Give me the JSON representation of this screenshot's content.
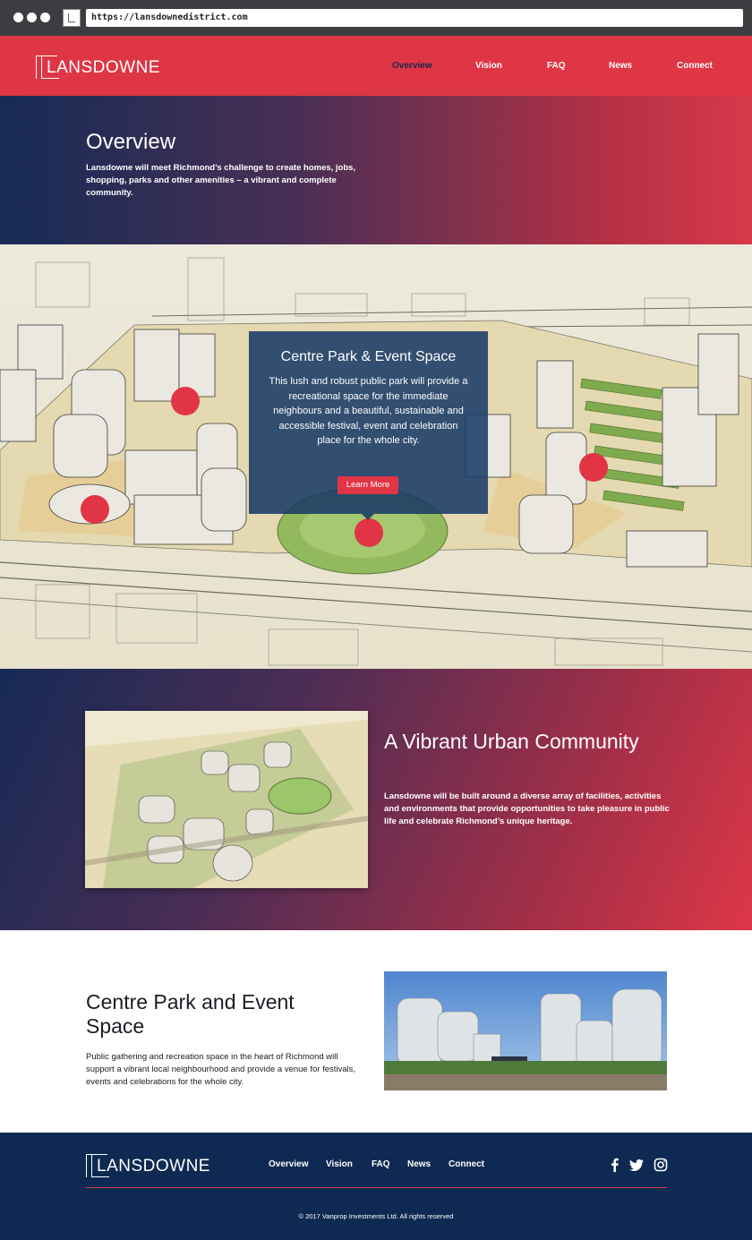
{
  "browser": {
    "url": "https://lansdownedistrict.com"
  },
  "header": {
    "logo": "LANSDOWNE",
    "nav": [
      {
        "label": "Overview",
        "active": true
      },
      {
        "label": "Vision",
        "active": false
      },
      {
        "label": "FAQ",
        "active": false
      },
      {
        "label": "News",
        "active": false
      },
      {
        "label": "Connect",
        "active": false
      }
    ]
  },
  "overview": {
    "title": "Overview",
    "text": "Lansdowne will meet Richmond’s challenge to create homes, jobs, shopping, parks and other amenities – a vibrant and complete community."
  },
  "map_popup": {
    "title": "Centre Park & Event Space",
    "text": "This lush and robust public park will provide a recreational space for the immediate neighbours and a beautiful, sustainable and accessible festival, event and celebration place for the whole city.",
    "button": "Learn More"
  },
  "vibrant": {
    "title": "A Vibrant Urban Community",
    "text": "Lansdowne will be built around a diverse array of facilities, activities and environments that provide opportunities to take pleasure in public life and celebrate Richmond’s unique heritage."
  },
  "park": {
    "title": "Centre Park and Event Space",
    "text": "Public gathering and recreation space in the heart of Richmond will support a vibrant local neighbourhood and provide a venue for festivals, events and celebrations for the whole city."
  },
  "footer": {
    "logo": "LANSDOWNE",
    "nav": [
      "Overview",
      "Vision",
      "FAQ",
      "News",
      "Connect"
    ],
    "social": [
      "facebook-icon",
      "twitter-icon",
      "instagram-icon"
    ],
    "copyright": "© 2017 Vanprop Investments Ltd. All rights reserved"
  },
  "colors": {
    "brand_red": "#df3645",
    "navy": "#0e2a52",
    "nav_active": "#1a2550"
  }
}
